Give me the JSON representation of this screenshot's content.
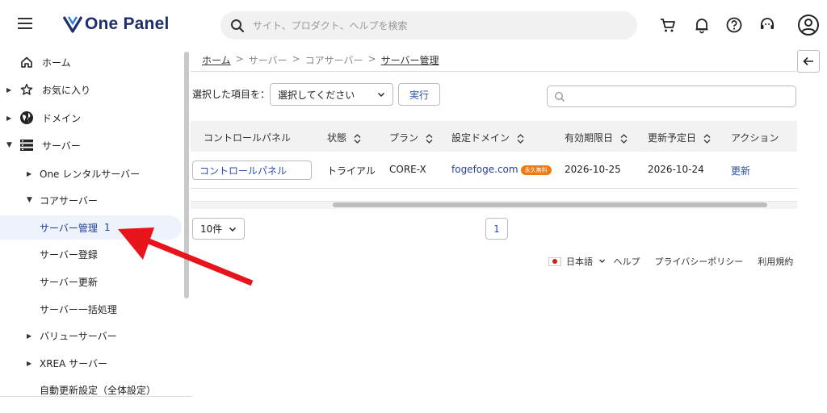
{
  "header": {
    "logo_text": "One Panel",
    "search_placeholder": "サイト、プロダクト、ヘルプを検索",
    "icons": [
      "menu-icon",
      "search-icon",
      "cart-icon",
      "bell-icon",
      "help-icon",
      "support-icon",
      "account-icon"
    ]
  },
  "sidebar": {
    "items": [
      {
        "label": "ホーム",
        "icon": "home-icon"
      },
      {
        "label": "お気に入り",
        "icon": "star-icon"
      },
      {
        "label": "ドメイン",
        "icon": "globe-icon"
      },
      {
        "label": "サーバー",
        "icon": "server-icon"
      },
      {
        "label": "One レンタルサーバー"
      },
      {
        "label": "コアサーバー"
      },
      {
        "label": "サーバー管理"
      },
      {
        "label": "サーバー登録"
      },
      {
        "label": "サーバー更新"
      },
      {
        "label": "サーバー一括処理"
      },
      {
        "label": "バリューサーバー"
      },
      {
        "label": "XREA サーバー"
      },
      {
        "label": "自動更新設定（全体設定）"
      }
    ],
    "active_annotation": "1"
  },
  "breadcrumb": [
    "ホーム",
    "サーバー",
    "コアサーバー",
    "サーバー管理"
  ],
  "breadcrumb_sep": ">",
  "bulk": {
    "label": "選択した項目を：",
    "select_value": "選択してください",
    "execute_label": "実行"
  },
  "table": {
    "headers": [
      "コントロールパネル",
      "状態",
      "プラン",
      "設定ドメイン",
      "有効期限日",
      "更新予定日",
      "アクション"
    ],
    "rows": [
      {
        "control_panel": "コントロールパネル",
        "status": "トライアル",
        "plan": "CORE-X",
        "domain": "fogefoge.com",
        "domain_badge": "永久無料",
        "expiry": "2026-10-25",
        "renewal": "2026-10-24",
        "action": "更新"
      }
    ]
  },
  "pagination": {
    "per_page": "10件",
    "current_page": "1"
  },
  "footer": {
    "language": "日本語",
    "links": [
      "ヘルプ",
      "プライバシーポリシー",
      "利用規約"
    ]
  },
  "colors": {
    "brand": "#1e2f6b",
    "link": "#2a4fa8",
    "badge": "#f07a16",
    "annotation_arrow": "#e8141b"
  }
}
